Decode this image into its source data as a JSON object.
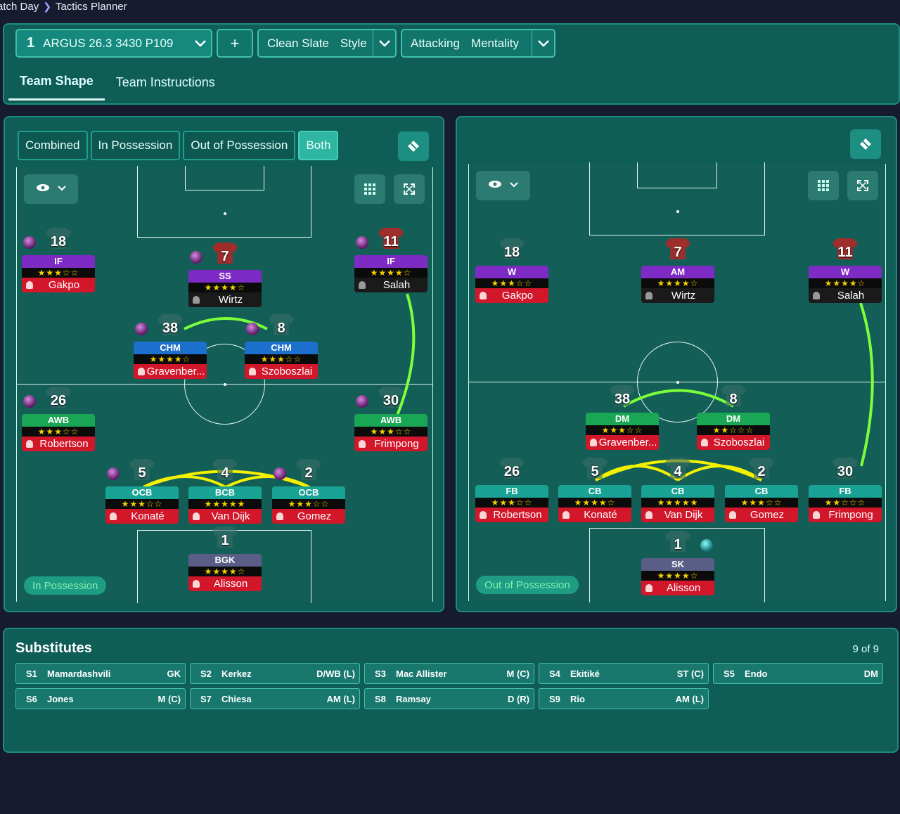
{
  "breadcrumb": {
    "parent": "atch Day",
    "current": "Tactics Planner"
  },
  "toolbar": {
    "tactic_num": "1",
    "tactic_name": "ARGUS 26.3 3430 P109",
    "add": "+",
    "style_value": "Clean Slate",
    "style_label": "Style",
    "mentality_value": "Attacking",
    "mentality_label": "Mentality"
  },
  "tabs": [
    "Team Shape",
    "Team Instructions"
  ],
  "phase_tabs": [
    "Combined",
    "In Possession",
    "Out of Possession",
    "Both"
  ],
  "left_panel": {
    "badge": "In Possession",
    "players": [
      {
        "num": "18",
        "pos": "IF",
        "stars": "★★★☆☆",
        "name": "Gakpo"
      },
      {
        "num": "7",
        "pos": "SS",
        "stars": "★★★★☆",
        "name": "Wirtz"
      },
      {
        "num": "11",
        "pos": "IF",
        "stars": "★★★★☆",
        "name": "Salah"
      },
      {
        "num": "38",
        "pos": "CHM",
        "stars": "★★★★☆",
        "name": "Gravenber..."
      },
      {
        "num": "8",
        "pos": "CHM",
        "stars": "★★★☆☆",
        "name": "Szoboszlai"
      },
      {
        "num": "26",
        "pos": "AWB",
        "stars": "★★★☆☆",
        "name": "Robertson"
      },
      {
        "num": "30",
        "pos": "AWB",
        "stars": "★★★☆☆",
        "name": "Frimpong"
      },
      {
        "num": "5",
        "pos": "OCB",
        "stars": "★★★☆☆",
        "name": "Konaté"
      },
      {
        "num": "4",
        "pos": "BCB",
        "stars": "★★★★★",
        "name": "Van Dijk"
      },
      {
        "num": "2",
        "pos": "OCB",
        "stars": "★★★☆☆",
        "name": "Gomez"
      },
      {
        "num": "1",
        "pos": "BGK",
        "stars": "★★★★☆",
        "name": "Alisson"
      }
    ]
  },
  "right_panel": {
    "badge": "Out of Possession",
    "players": [
      {
        "num": "18",
        "pos": "W",
        "stars": "★★★☆☆",
        "name": "Gakpo"
      },
      {
        "num": "7",
        "pos": "AM",
        "stars": "★★★★☆",
        "name": "Wirtz"
      },
      {
        "num": "11",
        "pos": "W",
        "stars": "★★★★☆",
        "name": "Salah"
      },
      {
        "num": "38",
        "pos": "DM",
        "stars": "★★★☆☆",
        "name": "Gravenber..."
      },
      {
        "num": "8",
        "pos": "DM",
        "stars": "★★☆☆☆",
        "name": "Szoboszlai"
      },
      {
        "num": "26",
        "pos": "FB",
        "stars": "★★★☆☆",
        "name": "Robertson"
      },
      {
        "num": "5",
        "pos": "CB",
        "stars": "★★★★☆",
        "name": "Konaté"
      },
      {
        "num": "4",
        "pos": "CB",
        "stars": "★★★★★",
        "name": "Van Dijk"
      },
      {
        "num": "2",
        "pos": "CB",
        "stars": "★★★☆☆",
        "name": "Gomez"
      },
      {
        "num": "30",
        "pos": "FB",
        "stars": "★★☆☆☆",
        "name": "Frimpong"
      },
      {
        "num": "1",
        "pos": "SK",
        "stars": "★★★★☆",
        "name": "Alisson"
      }
    ]
  },
  "substitutes": {
    "title": "Substitutes",
    "count": "9 of 9",
    "items": [
      {
        "slot": "S1",
        "name": "Mamardashvili",
        "pos": "GK"
      },
      {
        "slot": "S2",
        "name": "Kerkez",
        "pos": "D/WB (L)"
      },
      {
        "slot": "S3",
        "name": "Mac Allister",
        "pos": "M (C)"
      },
      {
        "slot": "S4",
        "name": "Ekitiké",
        "pos": "ST (C)"
      },
      {
        "slot": "S5",
        "name": "Endo",
        "pos": "DM"
      },
      {
        "slot": "S6",
        "name": "Jones",
        "pos": "M (C)"
      },
      {
        "slot": "S7",
        "name": "Chiesa",
        "pos": "AM (L)"
      },
      {
        "slot": "S8",
        "name": "Ramsay",
        "pos": "D (R)"
      },
      {
        "slot": "S9",
        "name": "Rio",
        "pos": "AM (L)"
      }
    ]
  },
  "colors": {
    "panel": "#0f5d57",
    "accent": "#2fb6a3",
    "link_green": "#7cff3a",
    "link_yellow": "#f3f000"
  }
}
